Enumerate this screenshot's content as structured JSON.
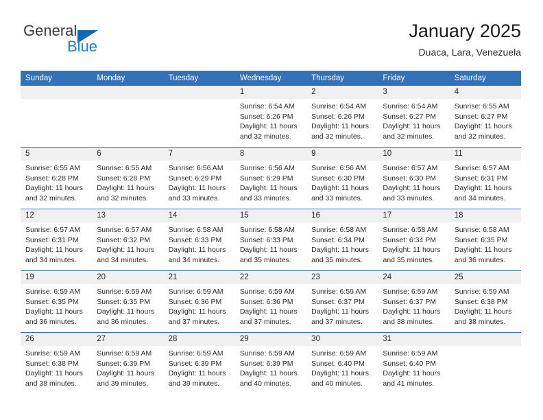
{
  "brand": {
    "name_part1": "General",
    "name_part2": "Blue",
    "triangle_color": "#1567b5",
    "blue_color": "#1f7fd0"
  },
  "header": {
    "title": "January 2025",
    "subtitle": "Duaca, Lara, Venezuela"
  },
  "theme": {
    "header_blue": "#3372b8",
    "date_band_gray": "#f0f0f0",
    "text": "#2c2c2c"
  },
  "weekdays": [
    "Sunday",
    "Monday",
    "Tuesday",
    "Wednesday",
    "Thursday",
    "Friday",
    "Saturday"
  ],
  "weeks": [
    [
      {
        "day": "",
        "lines": []
      },
      {
        "day": "",
        "lines": []
      },
      {
        "day": "",
        "lines": []
      },
      {
        "day": "1",
        "lines": [
          "Sunrise: 6:54 AM",
          "Sunset: 6:26 PM",
          "Daylight: 11 hours",
          "and 32 minutes."
        ]
      },
      {
        "day": "2",
        "lines": [
          "Sunrise: 6:54 AM",
          "Sunset: 6:26 PM",
          "Daylight: 11 hours",
          "and 32 minutes."
        ]
      },
      {
        "day": "3",
        "lines": [
          "Sunrise: 6:54 AM",
          "Sunset: 6:27 PM",
          "Daylight: 11 hours",
          "and 32 minutes."
        ]
      },
      {
        "day": "4",
        "lines": [
          "Sunrise: 6:55 AM",
          "Sunset: 6:27 PM",
          "Daylight: 11 hours",
          "and 32 minutes."
        ]
      }
    ],
    [
      {
        "day": "5",
        "lines": [
          "Sunrise: 6:55 AM",
          "Sunset: 6:28 PM",
          "Daylight: 11 hours",
          "and 32 minutes."
        ]
      },
      {
        "day": "6",
        "lines": [
          "Sunrise: 6:55 AM",
          "Sunset: 6:28 PM",
          "Daylight: 11 hours",
          "and 32 minutes."
        ]
      },
      {
        "day": "7",
        "lines": [
          "Sunrise: 6:56 AM",
          "Sunset: 6:29 PM",
          "Daylight: 11 hours",
          "and 33 minutes."
        ]
      },
      {
        "day": "8",
        "lines": [
          "Sunrise: 6:56 AM",
          "Sunset: 6:29 PM",
          "Daylight: 11 hours",
          "and 33 minutes."
        ]
      },
      {
        "day": "9",
        "lines": [
          "Sunrise: 6:56 AM",
          "Sunset: 6:30 PM",
          "Daylight: 11 hours",
          "and 33 minutes."
        ]
      },
      {
        "day": "10",
        "lines": [
          "Sunrise: 6:57 AM",
          "Sunset: 6:30 PM",
          "Daylight: 11 hours",
          "and 33 minutes."
        ]
      },
      {
        "day": "11",
        "lines": [
          "Sunrise: 6:57 AM",
          "Sunset: 6:31 PM",
          "Daylight: 11 hours",
          "and 34 minutes."
        ]
      }
    ],
    [
      {
        "day": "12",
        "lines": [
          "Sunrise: 6:57 AM",
          "Sunset: 6:31 PM",
          "Daylight: 11 hours",
          "and 34 minutes."
        ]
      },
      {
        "day": "13",
        "lines": [
          "Sunrise: 6:57 AM",
          "Sunset: 6:32 PM",
          "Daylight: 11 hours",
          "and 34 minutes."
        ]
      },
      {
        "day": "14",
        "lines": [
          "Sunrise: 6:58 AM",
          "Sunset: 6:33 PM",
          "Daylight: 11 hours",
          "and 34 minutes."
        ]
      },
      {
        "day": "15",
        "lines": [
          "Sunrise: 6:58 AM",
          "Sunset: 6:33 PM",
          "Daylight: 11 hours",
          "and 35 minutes."
        ]
      },
      {
        "day": "16",
        "lines": [
          "Sunrise: 6:58 AM",
          "Sunset: 6:34 PM",
          "Daylight: 11 hours",
          "and 35 minutes."
        ]
      },
      {
        "day": "17",
        "lines": [
          "Sunrise: 6:58 AM",
          "Sunset: 6:34 PM",
          "Daylight: 11 hours",
          "and 35 minutes."
        ]
      },
      {
        "day": "18",
        "lines": [
          "Sunrise: 6:58 AM",
          "Sunset: 6:35 PM",
          "Daylight: 11 hours",
          "and 36 minutes."
        ]
      }
    ],
    [
      {
        "day": "19",
        "lines": [
          "Sunrise: 6:59 AM",
          "Sunset: 6:35 PM",
          "Daylight: 11 hours",
          "and 36 minutes."
        ]
      },
      {
        "day": "20",
        "lines": [
          "Sunrise: 6:59 AM",
          "Sunset: 6:35 PM",
          "Daylight: 11 hours",
          "and 36 minutes."
        ]
      },
      {
        "day": "21",
        "lines": [
          "Sunrise: 6:59 AM",
          "Sunset: 6:36 PM",
          "Daylight: 11 hours",
          "and 37 minutes."
        ]
      },
      {
        "day": "22",
        "lines": [
          "Sunrise: 6:59 AM",
          "Sunset: 6:36 PM",
          "Daylight: 11 hours",
          "and 37 minutes."
        ]
      },
      {
        "day": "23",
        "lines": [
          "Sunrise: 6:59 AM",
          "Sunset: 6:37 PM",
          "Daylight: 11 hours",
          "and 37 minutes."
        ]
      },
      {
        "day": "24",
        "lines": [
          "Sunrise: 6:59 AM",
          "Sunset: 6:37 PM",
          "Daylight: 11 hours",
          "and 38 minutes."
        ]
      },
      {
        "day": "25",
        "lines": [
          "Sunrise: 6:59 AM",
          "Sunset: 6:38 PM",
          "Daylight: 11 hours",
          "and 38 minutes."
        ]
      }
    ],
    [
      {
        "day": "26",
        "lines": [
          "Sunrise: 6:59 AM",
          "Sunset: 6:38 PM",
          "Daylight: 11 hours",
          "and 38 minutes."
        ]
      },
      {
        "day": "27",
        "lines": [
          "Sunrise: 6:59 AM",
          "Sunset: 6:39 PM",
          "Daylight: 11 hours",
          "and 39 minutes."
        ]
      },
      {
        "day": "28",
        "lines": [
          "Sunrise: 6:59 AM",
          "Sunset: 6:39 PM",
          "Daylight: 11 hours",
          "and 39 minutes."
        ]
      },
      {
        "day": "29",
        "lines": [
          "Sunrise: 6:59 AM",
          "Sunset: 6:39 PM",
          "Daylight: 11 hours",
          "and 40 minutes."
        ]
      },
      {
        "day": "30",
        "lines": [
          "Sunrise: 6:59 AM",
          "Sunset: 6:40 PM",
          "Daylight: 11 hours",
          "and 40 minutes."
        ]
      },
      {
        "day": "31",
        "lines": [
          "Sunrise: 6:59 AM",
          "Sunset: 6:40 PM",
          "Daylight: 11 hours",
          "and 41 minutes."
        ]
      },
      {
        "day": "",
        "lines": []
      }
    ]
  ]
}
